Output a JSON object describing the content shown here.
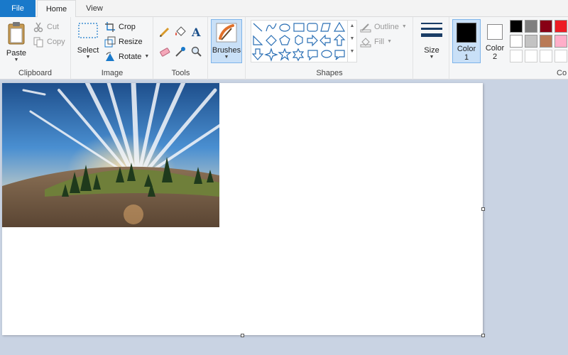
{
  "tabs": {
    "file": "File",
    "home": "Home",
    "view": "View"
  },
  "clipboard": {
    "paste": "Paste",
    "cut": "Cut",
    "copy": "Copy",
    "label": "Clipboard"
  },
  "image": {
    "select": "Select",
    "crop": "Crop",
    "resize": "Resize",
    "rotate": "Rotate",
    "label": "Image"
  },
  "tools": {
    "label": "Tools"
  },
  "brushes": {
    "label": "Brushes"
  },
  "shapes": {
    "outline": "Outline",
    "fill": "Fill",
    "label": "Shapes"
  },
  "size": {
    "label": "Size"
  },
  "colors": {
    "color1": "Color",
    "color1_num": "1",
    "color2": "Color",
    "color2_num": "2",
    "group_label_partial": "Co",
    "accent": "#1979ca",
    "primary_swatch": "#000000",
    "secondary_swatch": "#ffffff",
    "palette_row1": [
      "#000000",
      "#7f7f7f",
      "#880015",
      "#ed1c24"
    ],
    "palette_row2": [
      "#ffffff",
      "#c3c3c3",
      "#b97a57",
      "#ffaec9"
    ]
  }
}
